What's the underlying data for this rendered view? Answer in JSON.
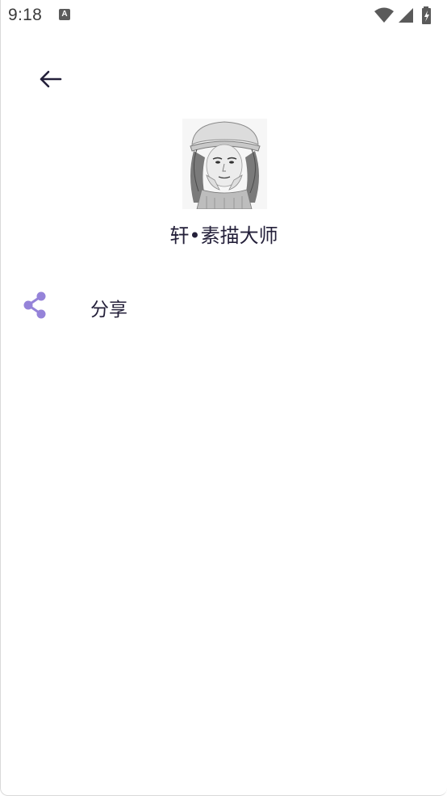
{
  "status_bar": {
    "time": "9:18",
    "app_icon_letter": "A",
    "icons": [
      "wifi-icon",
      "signal-icon",
      "battery-charging-icon"
    ]
  },
  "navigation": {
    "back_icon": "arrow-left-icon"
  },
  "header": {
    "title": "轩•素描大师",
    "avatar_description": "sketch-portrait-icon"
  },
  "menu": {
    "items": [
      {
        "icon": "share-icon",
        "label": "分享"
      }
    ]
  },
  "colors": {
    "accent": "#9583d9",
    "title_text": "#24203a",
    "status_text": "#3a3a3a",
    "background": "#ffffff"
  }
}
